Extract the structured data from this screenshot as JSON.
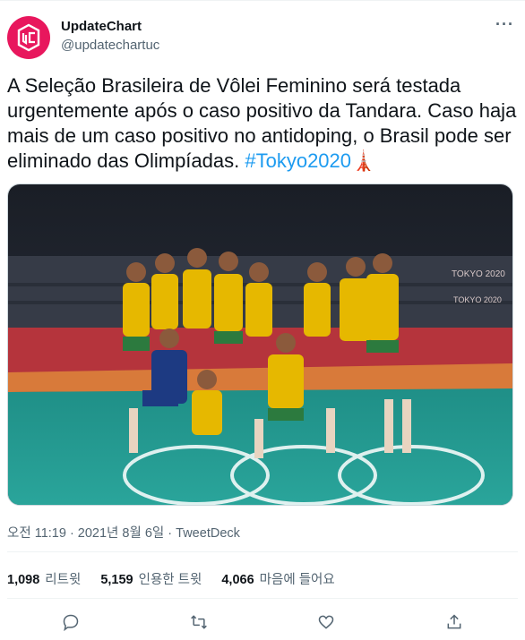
{
  "author": {
    "display_name": "UpdateChart",
    "handle": "@updatechartuc",
    "avatar_color": "#e8175d"
  },
  "tweet": {
    "text": "A Seleção Brasileira de Vôlei Feminino será testada urgentemente após o caso positivo da Tandara. Caso haja mais de um caso positivo no antidoping, o Brasil pode ser eliminado das Olimpíadas. ",
    "hashtag": "#Tokyo2020",
    "emoji": "🗼",
    "media_texts": [
      "TOKYO 2020",
      "TOKYO 2020"
    ]
  },
  "meta": {
    "timestamp": "오전 11:19 · 2021년 8월 6일 · ",
    "source": "TweetDeck"
  },
  "stats": {
    "retweets_count": "1,098",
    "retweets_label": "리트윗",
    "quotes_count": "5,159",
    "quotes_label": "인용한 트윗",
    "likes_count": "4,066",
    "likes_label": "마음에 들어요"
  },
  "colors": {
    "link": "#1d9bf0",
    "secondary_text": "#536471",
    "brand_pink": "#e8175d"
  },
  "icons": [
    "more-icon",
    "reply-icon",
    "retweet-icon",
    "like-icon",
    "share-icon"
  ]
}
